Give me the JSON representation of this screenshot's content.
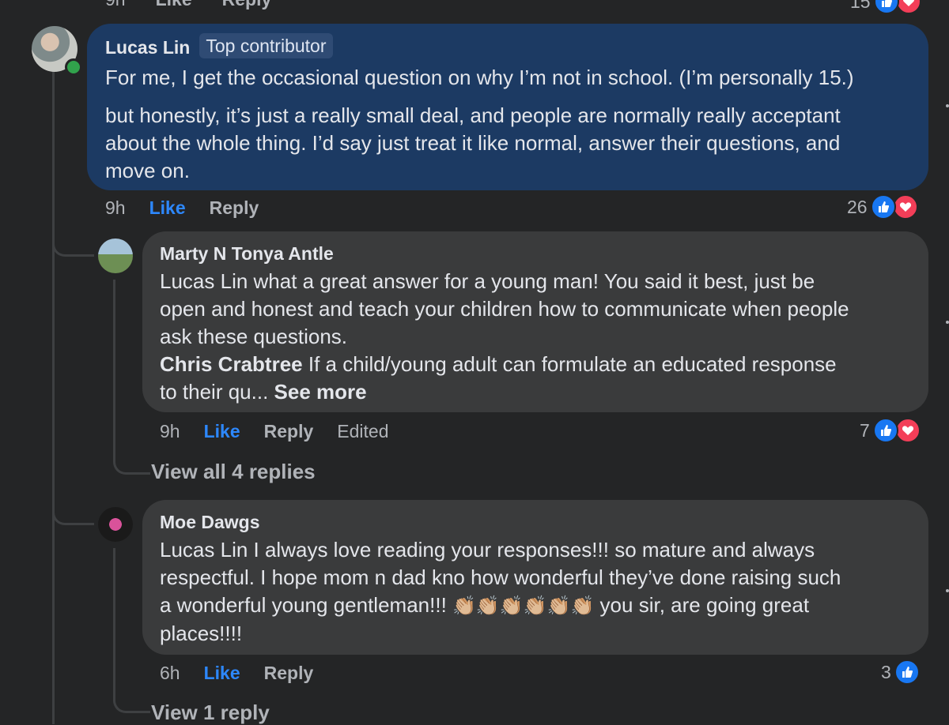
{
  "top_partial": {
    "time": "9h",
    "like": "Like",
    "reply": "Reply",
    "count": "15"
  },
  "comment_main": {
    "author": "Lucas Lin",
    "badge": "Top contributor",
    "paragraph1": "For me, I get the occasional question on why I’m not in school. (I’m personally 15.)",
    "paragraph2_line1": "but honestly, it’s just a really small deal, and people are normally really acceptant",
    "paragraph2_line2": "about the whole thing. I’d say just treat it like normal, answer their questions, and",
    "paragraph2_line3": "move on.",
    "time": "9h",
    "like": "Like",
    "reply": "Reply",
    "reactions": "26"
  },
  "reply_marty": {
    "author": "Marty N Tonya Antle",
    "line1": "Lucas Lin what a great answer for a young man! You said it best, just be",
    "line2": "open and honest and teach your children how to communicate when people",
    "line3": "ask these questions.",
    "sub_author": "Chris Crabtree",
    "sub_line1": " If a child/young adult can formulate an educated response",
    "sub_line2": "to their qu... ",
    "see_more": "See more",
    "time": "9h",
    "like": "Like",
    "reply": "Reply",
    "edited": "Edited",
    "reactions": "7",
    "view_replies": "View all 4 replies"
  },
  "reply_moe": {
    "author": "Moe Dawgs",
    "line1": "Lucas Lin I always love reading your responses!!! so mature and always",
    "line2": "respectful. I hope mom n dad kno how wonderful they’ve done raising such",
    "line3_start": "a wonderful young gentleman!!! ",
    "claps": "👏🏼👏🏼👏🏼👏🏼👏🏼👏🏼",
    "line3_end": " you sir, are going great",
    "line4": "places!!!!",
    "time": "6h",
    "like": "Like",
    "reply": "Reply",
    "reactions": "3",
    "view_replies": "View 1 reply"
  },
  "icons": [
    "thumbs-up-icon",
    "heart-icon"
  ],
  "colors": {
    "background": "#242526",
    "highlight_bubble": "#1c3a63",
    "bubble": "#3a3b3c",
    "like_blue": "#2d88ff",
    "love_red": "#f33e58"
  }
}
